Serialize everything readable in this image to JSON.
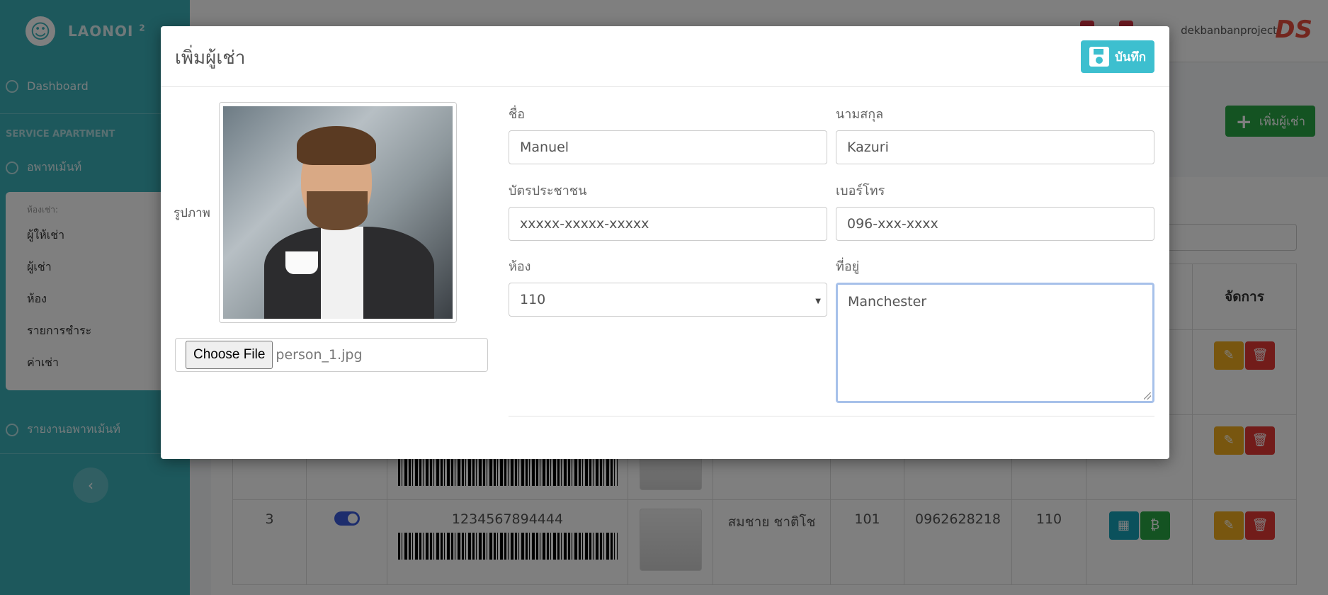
{
  "brand": {
    "name": "LAONOI",
    "sup": "2"
  },
  "sidebar": {
    "dashboard": "Dashboard",
    "section": "SERVICE APARTMENT",
    "apartment": "อพาทเม้นท์",
    "sub_header": "ห้องเช่า:",
    "sub_items": [
      "ผู้ให้เช่า",
      "ผู้เช่า",
      "ห้อง",
      "รายการชำระ",
      "ค่าเช่า"
    ],
    "report": "รายงานอพาทเม้นท์"
  },
  "topbar": {
    "user": "dekbanbanproject",
    "logo": "DS"
  },
  "page": {
    "add_button": "เพิ่มผู้เช่า"
  },
  "table": {
    "manage_header": "จัดการ",
    "row": {
      "no": "3",
      "id_number": "1234567894444",
      "name": "สมชาย  ชาติโช",
      "room_code": "101",
      "phone": "0962628218",
      "room": "110"
    }
  },
  "modal": {
    "title": "เพิ่มผู้เช่า",
    "save_label": "บันทึก",
    "photo_label": "รูปภาพ",
    "file_button": "Choose File",
    "file_name": "person_1.jpg",
    "first_name_label": "ชื่อ",
    "first_name": "Manuel",
    "last_name_label": "นามสกุล",
    "last_name": "Kazuri",
    "id_card_label": "บัตรประชาชน",
    "id_card": "xxxxx-xxxxx-xxxxx",
    "phone_label": "เบอร์โทร",
    "phone": "096-xxx-xxxx",
    "room_label": "ห้อง",
    "room": "110",
    "address_label": "ที่อยู่",
    "address": "Manchester"
  }
}
